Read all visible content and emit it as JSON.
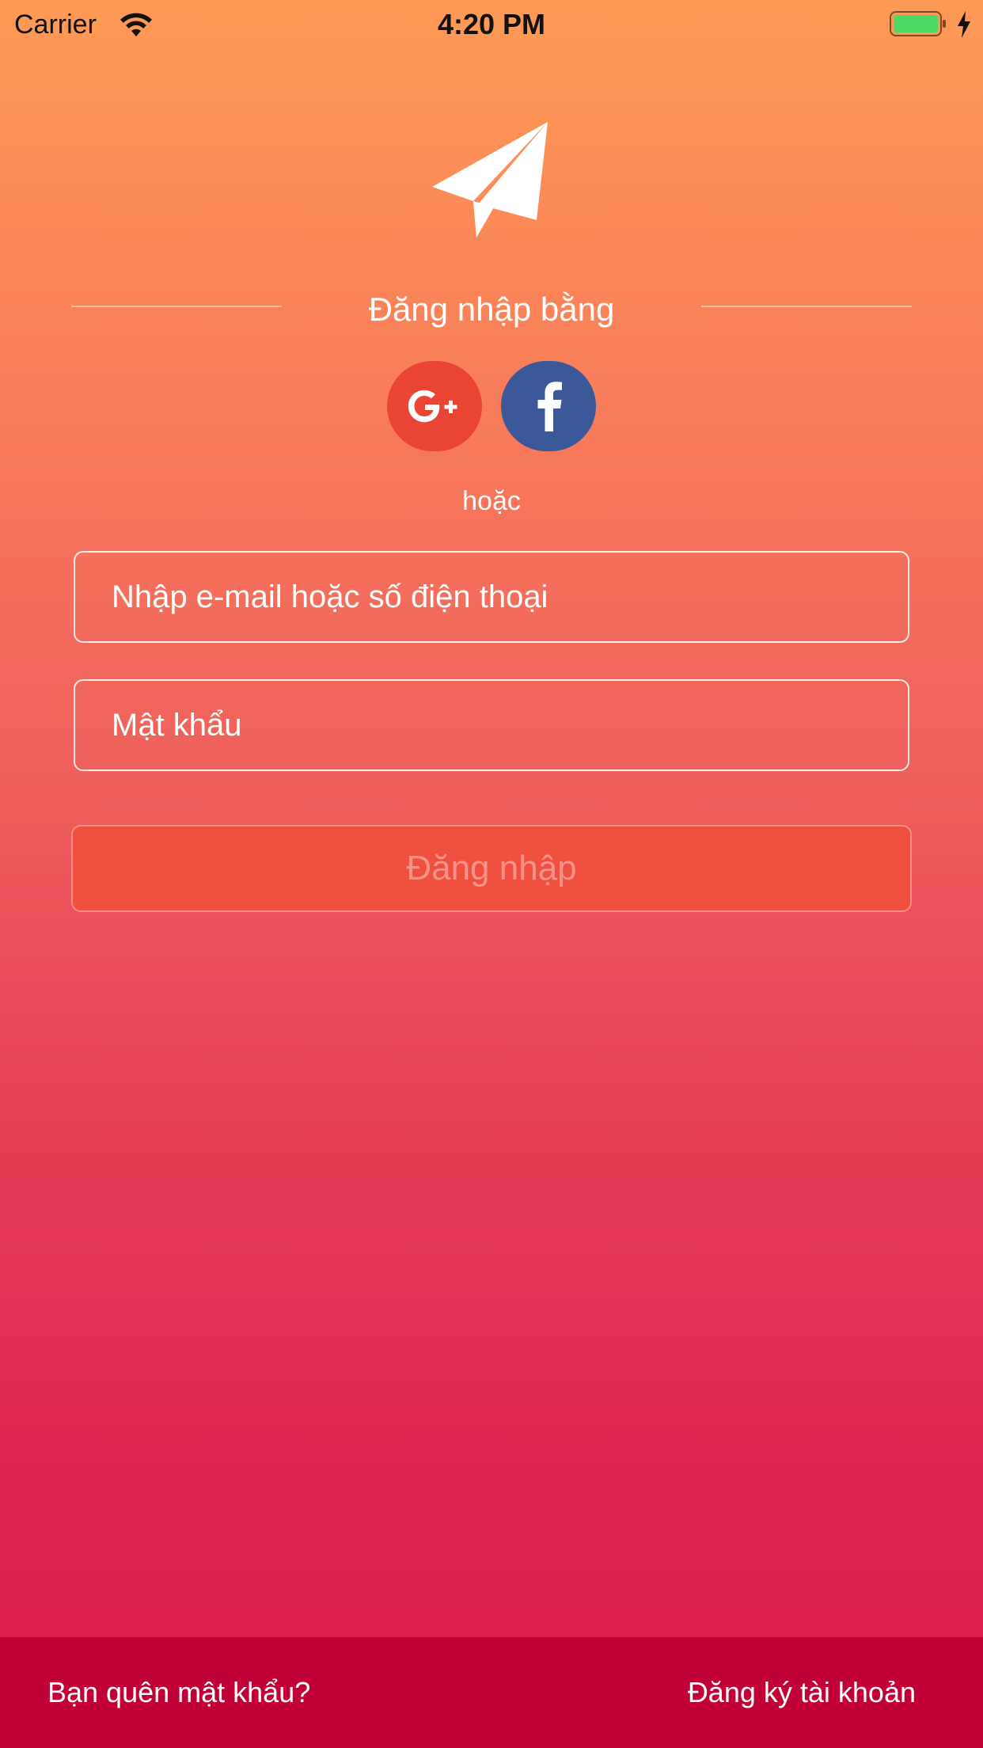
{
  "status_bar": {
    "carrier": "Carrier",
    "time": "4:20 PM",
    "wifi_icon": "wifi-icon",
    "battery_icon": "battery-icon",
    "charging_icon": "charging-bolt-icon",
    "battery_color": "#4cd964"
  },
  "logo": {
    "icon": "paper-plane-icon"
  },
  "social_login": {
    "heading": "Đăng nhập bằng",
    "google_icon": "google-plus-icon",
    "google_color": "#ea4435",
    "facebook_icon": "facebook-icon",
    "facebook_color": "#3b5998",
    "or_text": "hoặc"
  },
  "form": {
    "email_placeholder": "Nhập e-mail hoặc số điện thoại",
    "password_placeholder": "Mật khẩu",
    "login_button": "Đăng nhập"
  },
  "footer": {
    "forgot_password": "Bạn quên mật khẩu?",
    "register": "Đăng ký tài khoản",
    "background_color": "#c10037"
  },
  "colors": {
    "gradient_top": "#ff9a55",
    "gradient_bottom": "#de1e4d",
    "login_button_bg": "#f05040"
  }
}
